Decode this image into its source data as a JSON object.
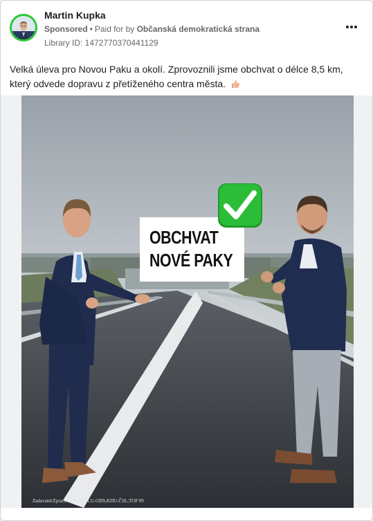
{
  "post": {
    "author": "Martin Kupka",
    "sponsored_label": "Sponsored",
    "separator": "•",
    "paid_prefix": "Paid for by",
    "payer": "Občanská demokratická strana",
    "library_id": "Library ID: 1472770370441129",
    "text": "Velká úleva pro Novou Paku a okolí. Zprovoznili jsme obchvat o délce 8,5 km, který odvede dopravu z přetíženého centra města."
  },
  "media": {
    "sign_line_1": "OBCHVAT",
    "sign_line_2": "NOVÉ PAKY",
    "credit": "Zadavatel/Zpracovatel: SPOLU-ODS,KDU-ČSL,TOP 09"
  },
  "icons": {
    "more": "more-options-icon",
    "check": "check-mark-icon",
    "thumb": "thumbs-up-emoji-icon"
  },
  "colors": {
    "avatar_ring": "#2ec73a",
    "check_green": "#2bbd37",
    "text_secondary": "#65676b"
  }
}
